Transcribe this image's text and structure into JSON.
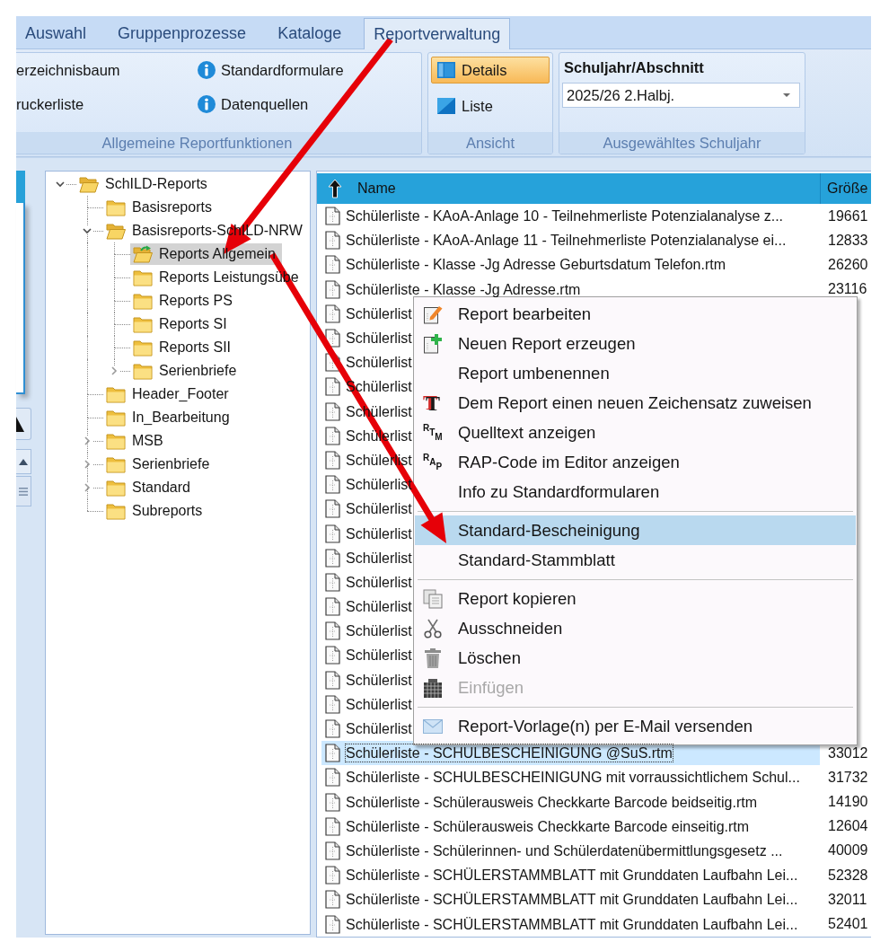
{
  "tabs": [
    {
      "label": "Auswahl",
      "selected": false
    },
    {
      "label": "Gruppenprozesse",
      "selected": false
    },
    {
      "label": "Kataloge",
      "selected": false
    },
    {
      "label": "Reportverwaltung",
      "selected": true
    }
  ],
  "ribbon": {
    "general": {
      "label": "Allgemeine Reportfunktionen",
      "columns": [
        [
          {
            "label": "erzeichnisbaum"
          },
          {
            "label": "ruckerliste"
          }
        ],
        [
          {
            "label": "Standardformulare"
          },
          {
            "label": "Datenquellen"
          }
        ]
      ]
    },
    "view": {
      "label": "Ansicht",
      "options": [
        {
          "label": "Details",
          "selected": true
        },
        {
          "label": "Liste",
          "selected": false
        }
      ]
    },
    "school_year": {
      "label": "Ausgewähltes Schuljahr",
      "field_label": "Schuljahr/Abschnitt",
      "value": "2025/26 2.Halbj."
    }
  },
  "tree": [
    {
      "label": "SchILD-Reports",
      "expandable": true,
      "expanded": true,
      "selected": false,
      "children": [
        {
          "label": "Basisreports",
          "expandable": false,
          "expanded": false,
          "selected": false
        },
        {
          "label": "Basisreports-SchILD-NRW",
          "expandable": true,
          "expanded": true,
          "selected": false,
          "children": [
            {
              "label": "Reports Allgemein",
              "expandable": false,
              "expanded": false,
              "selected": true
            },
            {
              "label": "Reports Leistungsübe",
              "expandable": false,
              "expanded": false,
              "selected": false
            },
            {
              "label": "Reports PS",
              "expandable": false,
              "expanded": false,
              "selected": false
            },
            {
              "label": "Reports SI",
              "expandable": false,
              "expanded": false,
              "selected": false
            },
            {
              "label": "Reports SII",
              "expandable": false,
              "expanded": false,
              "selected": false
            },
            {
              "label": "Serienbriefe",
              "expandable": true,
              "expanded": false,
              "selected": false
            }
          ]
        },
        {
          "label": "Header_Footer",
          "expandable": false,
          "expanded": false,
          "selected": false
        },
        {
          "label": "In_Bearbeitung",
          "expandable": false,
          "expanded": false,
          "selected": false
        },
        {
          "label": "MSB",
          "expandable": true,
          "expanded": false,
          "selected": false
        },
        {
          "label": "Serienbriefe",
          "expandable": true,
          "expanded": false,
          "selected": false
        },
        {
          "label": "Standard",
          "expandable": true,
          "expanded": false,
          "selected": false
        },
        {
          "label": "Subreports",
          "expandable": false,
          "expanded": false,
          "selected": false
        }
      ]
    }
  ],
  "file_list": {
    "columns": [
      "Name",
      "Größe"
    ],
    "rows": [
      {
        "name": "Schülerliste - KAoA-Anlage 10 - Teilnehmerliste Potenzialanalyse z...",
        "size": "19661",
        "selected": false
      },
      {
        "name": "Schülerliste - KAoA-Anlage 11 - Teilnehmerliste Potenzialanalyse ei...",
        "size": "12833",
        "selected": false
      },
      {
        "name": "Schülerliste - Klasse -Jg Adresse Geburtsdatum Telefon.rtm",
        "size": "26260",
        "selected": false
      },
      {
        "name": "Schülerliste - Klasse -Jg Adresse.rtm",
        "size": "23116",
        "selected": false
      },
      {
        "name": "Schülerlist",
        "selected": false
      },
      {
        "name": "Schülerlist",
        "selected": false
      },
      {
        "name": "Schülerlist",
        "selected": false
      },
      {
        "name": "Schülerlist",
        "selected": false
      },
      {
        "name": "Schülerlist",
        "selected": false
      },
      {
        "name": "Schülerlist",
        "selected": false
      },
      {
        "name": "Schülerlist",
        "selected": false
      },
      {
        "name": "Schülerlist",
        "selected": false
      },
      {
        "name": "Schülerlist",
        "selected": false
      },
      {
        "name": "Schülerlist",
        "selected": false
      },
      {
        "name": "Schülerlist",
        "selected": false
      },
      {
        "name": "Schülerlist",
        "selected": false
      },
      {
        "name": "Schülerlist",
        "selected": false
      },
      {
        "name": "Schülerlist",
        "selected": false
      },
      {
        "name": "Schülerlist",
        "selected": false
      },
      {
        "name": "Schülerlist",
        "selected": false
      },
      {
        "name": "Schülerlist",
        "selected": false
      },
      {
        "name": "Schülerlist",
        "selected": false
      },
      {
        "name": "Schülerliste - SCHULBESCHEINIGUNG @SuS.rtm",
        "size": "33012",
        "selected": true
      },
      {
        "name": "Schülerliste - SCHULBESCHEINIGUNG mit vorraussichtlichem Schul...",
        "size": "31732",
        "selected": false
      },
      {
        "name": "Schülerliste - Schülerausweis Checkkarte Barcode beidseitig.rtm",
        "size": "14190",
        "selected": false
      },
      {
        "name": "Schülerliste - Schülerausweis Checkkarte Barcode einseitig.rtm",
        "size": "12604",
        "selected": false
      },
      {
        "name": "Schülerliste - Schülerinnen- und Schülerdatenübermittlungsgesetz ...",
        "size": "40009",
        "selected": false
      },
      {
        "name": "Schülerliste - SCHÜLERSTAMMBLATT mit Grunddaten Laufbahn Lei...",
        "size": "52328",
        "selected": false
      },
      {
        "name": "Schülerliste - SCHÜLERSTAMMBLATT mit Grunddaten Laufbahn Lei...",
        "size": "32011",
        "selected": false
      },
      {
        "name": "Schülerliste - SCHÜLERSTAMMBLATT mit Grunddaten Laufbahn Lei...",
        "size": "52401",
        "selected": false
      }
    ]
  },
  "context_menu": {
    "sections": [
      [
        {
          "label": "Report bearbeiten",
          "selected": false,
          "disabled": false
        },
        {
          "label": "Neuen Report erzeugen",
          "selected": false,
          "disabled": false
        },
        {
          "label": "Report umbenennen",
          "selected": false,
          "disabled": false
        },
        {
          "label": "Dem Report einen neuen Zeichensatz zuweisen",
          "icon_text": "T",
          "selected": false,
          "disabled": false
        },
        {
          "label": "Quelltext anzeigen",
          "icon_text": "RTM",
          "selected": false,
          "disabled": false
        },
        {
          "label": "RAP-Code im Editor anzeigen",
          "icon_text": "RAP",
          "selected": false,
          "disabled": false
        },
        {
          "label": "Info zu Standardformularen",
          "selected": false,
          "disabled": false
        }
      ],
      [
        {
          "label": "Standard-Bescheinigung",
          "selected": true,
          "disabled": false
        },
        {
          "label": "Standard-Stammblatt",
          "selected": false,
          "disabled": false
        }
      ],
      [
        {
          "label": "Report kopieren",
          "selected": false,
          "disabled": false
        },
        {
          "label": "Ausschneiden",
          "selected": false,
          "disabled": false
        },
        {
          "label": "Löschen",
          "selected": false,
          "disabled": false
        },
        {
          "label": "Einfügen",
          "selected": false,
          "disabled": true
        }
      ],
      [
        {
          "label": "Report-Vorlage(n) per E-Mail versenden",
          "selected": false,
          "disabled": false
        }
      ]
    ]
  }
}
